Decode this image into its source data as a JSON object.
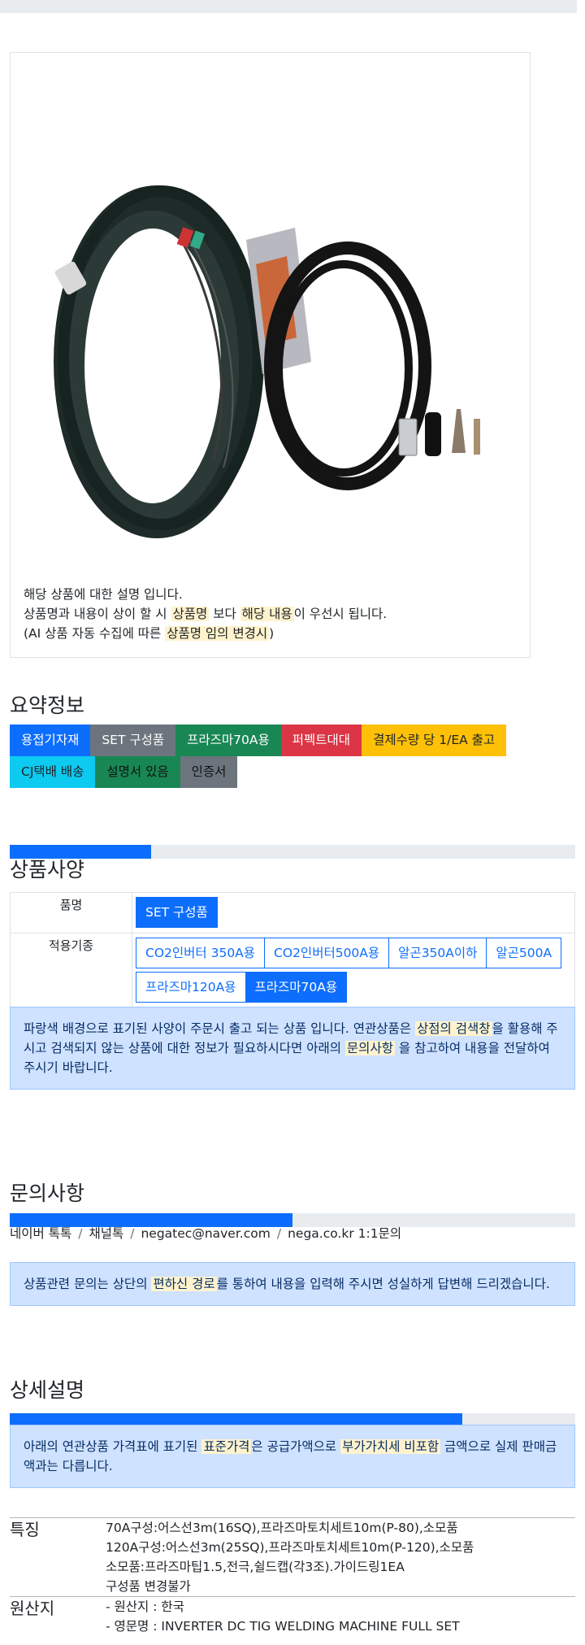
{
  "product": {
    "description": {
      "line1": "해당 상품에 대한 설명 입니다.",
      "line2_a": "상품명과 내용이 상이 할 시 ",
      "line2_hl1": "상품명",
      "line2_b": " 보다 ",
      "line2_hl2": "해당 내용",
      "line2_c": "이 우선시 됩니다.",
      "line3_a": "(AI 상품 자동 수집에 따른 ",
      "line3_hl": "상품명 임의 변경시",
      "line3_b": ")"
    }
  },
  "summary": {
    "title": "요약정보",
    "badges": [
      "용접기자재",
      "SET 구성품",
      "프라즈마70A용",
      "퍼펙트대대",
      "결제수량 당 1/EA 출고",
      "CJ택배 배송",
      "설명서 있음",
      "인증서"
    ]
  },
  "spec": {
    "title": "상품사양",
    "progress": 0.25,
    "rows": [
      {
        "label": "품명",
        "options": [
          "SET 구성품"
        ]
      },
      {
        "label": "적용기종",
        "options": [
          "CO2인버터 350A용",
          "CO2인버터500A용",
          "알곤350A이하",
          "알곤500A",
          "프라즈마120A용",
          "프라즈마70A용"
        ]
      }
    ],
    "notice_a": "파랑색 배경으로 표기된 사양이 주문시 출고 되는 상품 입니다. 연관상품은 ",
    "notice_hl1": "상점의 검색창",
    "notice_b": "을 활용해 주시고 검색되지 않는 상품에 대한 정보가 필요하시다면 아래의 ",
    "notice_hl2": "문의사항",
    "notice_c": " 을 참고하여 내용을 전달하여 주시기 바랍니다."
  },
  "inquiry": {
    "title": "문의사항",
    "progress": 0.5,
    "links": [
      "네이버 톡톡",
      "채널톡",
      "negatec@naver.com",
      "nega.co.kr 1:1문의"
    ],
    "notice_a": "상품관련 문의는 상단의 ",
    "notice_hl": "편하신 경로",
    "notice_b": "를 통하여 내용을 입력해 주시면 성실하게 답변해 드리겠습니다."
  },
  "detail": {
    "title": "상세설명",
    "progress": 0.8,
    "notice_a": "아래의 연관상품 가격표에 표기된 ",
    "notice_hl1": "표준가격",
    "notice_b": "은 공급가액으로 ",
    "notice_hl2": "부가가치세 비포함",
    "notice_c": " 금액으로 실제 판매금액과는 다릅니다.",
    "rows": [
      {
        "label": "특징",
        "lines": [
          "70A구성:어스선3m(16SQ),프라즈마토치세트10m(P-80),소모품",
          "120A구성:어스선3m(25SQ),프라즈마토치세트10m(P-120),소모품",
          "소모품:프라즈마팁1.5,전극,쉴드캡(각3조).가이드링1EA",
          "구성품 변경불가"
        ]
      },
      {
        "label": "원산지",
        "lines": [
          "- 원산지 : 한국",
          "- 영문명 : INVERTER DC TIG WELDING MACHINE FULL SET"
        ]
      }
    ]
  },
  "colors": {
    "primary": "#0d6efd",
    "highlight": "#fff3cd",
    "alert_bg": "#cfe2ff"
  }
}
